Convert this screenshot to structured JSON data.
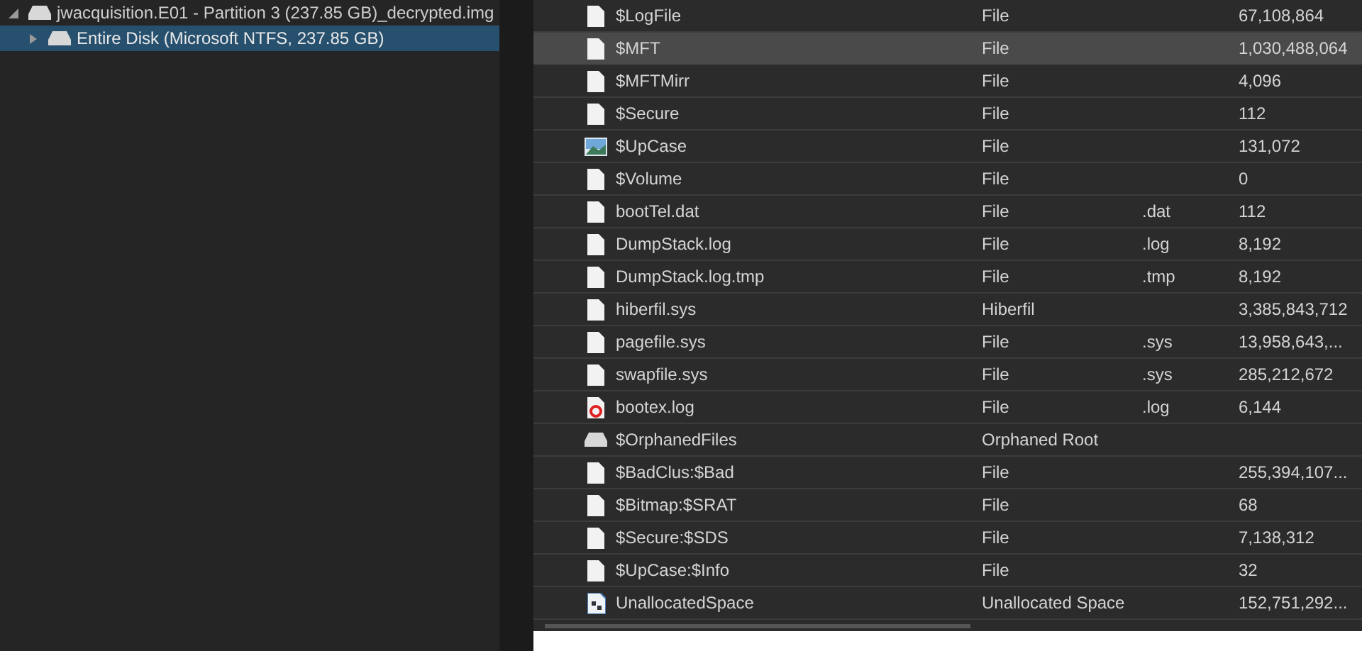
{
  "tree": {
    "items": [
      {
        "label": "jwacquisition.E01 - Partition 3 (237.85 GB)_decrypted.img",
        "expanded": true,
        "selected": false,
        "children": [
          {
            "label": "Entire Disk (Microsoft NTFS, 237.85 GB)",
            "expanded": false,
            "selected": true
          }
        ]
      }
    ]
  },
  "table": {
    "rows": [
      {
        "kind": "file",
        "name": "$LogFile",
        "type": "File",
        "ext": "",
        "size": "67,108,864",
        "selected": false
      },
      {
        "kind": "file",
        "name": "$MFT",
        "type": "File",
        "ext": "",
        "size": "1,030,488,064",
        "selected": true
      },
      {
        "kind": "file",
        "name": "$MFTMirr",
        "type": "File",
        "ext": "",
        "size": "4,096",
        "selected": false
      },
      {
        "kind": "file",
        "name": "$Secure",
        "type": "File",
        "ext": "",
        "size": "112",
        "selected": false
      },
      {
        "kind": "image",
        "name": "$UpCase",
        "type": "File",
        "ext": "",
        "size": "131,072",
        "selected": false
      },
      {
        "kind": "file",
        "name": "$Volume",
        "type": "File",
        "ext": "",
        "size": "0",
        "selected": false
      },
      {
        "kind": "file",
        "name": "bootTel.dat",
        "type": "File",
        "ext": ".dat",
        "size": "112",
        "selected": false
      },
      {
        "kind": "file",
        "name": "DumpStack.log",
        "type": "File",
        "ext": ".log",
        "size": "8,192",
        "selected": false
      },
      {
        "kind": "file",
        "name": "DumpStack.log.tmp",
        "type": "File",
        "ext": ".tmp",
        "size": "8,192",
        "selected": false
      },
      {
        "kind": "file",
        "name": "hiberfil.sys",
        "type": "Hiberfil",
        "ext": "",
        "size": "3,385,843,712",
        "selected": false
      },
      {
        "kind": "file",
        "name": "pagefile.sys",
        "type": "File",
        "ext": ".sys",
        "size": "13,958,643,...",
        "selected": false
      },
      {
        "kind": "file",
        "name": "swapfile.sys",
        "type": "File",
        "ext": ".sys",
        "size": "285,212,672",
        "selected": false
      },
      {
        "kind": "error",
        "name": "bootex.log",
        "type": "File",
        "ext": ".log",
        "size": "6,144",
        "selected": false
      },
      {
        "kind": "drive",
        "name": "$OrphanedFiles",
        "type": "Orphaned Root",
        "ext": "",
        "size": "",
        "selected": false
      },
      {
        "kind": "file",
        "name": "$BadClus:$Bad",
        "type": "File",
        "ext": "",
        "size": "255,394,107...",
        "selected": false
      },
      {
        "kind": "file",
        "name": "$Bitmap:$SRAT",
        "type": "File",
        "ext": "",
        "size": "68",
        "selected": false
      },
      {
        "kind": "file",
        "name": "$Secure:$SDS",
        "type": "File",
        "ext": "",
        "size": "7,138,312",
        "selected": false
      },
      {
        "kind": "file",
        "name": "$UpCase:$Info",
        "type": "File",
        "ext": "",
        "size": "32",
        "selected": false
      },
      {
        "kind": "unallocated",
        "name": "UnallocatedSpace",
        "type": "Unallocated Space",
        "ext": "",
        "size": "152,751,292...",
        "selected": false
      }
    ]
  }
}
